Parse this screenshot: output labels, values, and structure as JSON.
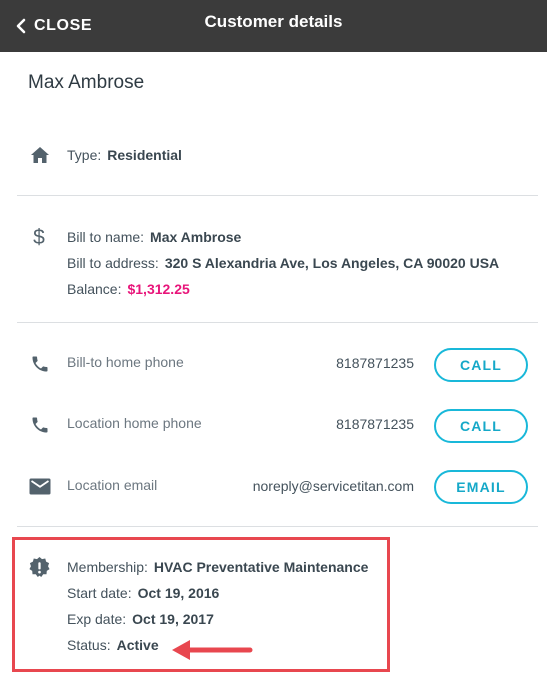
{
  "header": {
    "close_label": "CLOSE",
    "title": "Customer details",
    "close_icon": "chevron-left-icon"
  },
  "customer": {
    "name": "Max Ambrose"
  },
  "type_section": {
    "icon": "home-icon",
    "label": "Type:",
    "value": "Residential"
  },
  "billing": {
    "icon": "dollar-icon",
    "bill_to_name_label": "Bill to name:",
    "bill_to_name_value": "Max Ambrose",
    "bill_to_address_label": "Bill to address:",
    "bill_to_address_value": "320 S Alexandria Ave, Los Angeles, CA 90020 USA",
    "balance_label": "Balance:",
    "balance_value": "$1,312.25",
    "balance_color": "#e8157a"
  },
  "contacts": [
    {
      "icon": "phone-icon",
      "label": "Bill-to home phone",
      "value": "8187871235",
      "action": "CALL"
    },
    {
      "icon": "phone-icon",
      "label": "Location home phone",
      "value": "8187871235",
      "action": "CALL"
    },
    {
      "icon": "email-icon",
      "label": "Location email",
      "value": "noreply@servicetitan.com",
      "action": "EMAIL"
    }
  ],
  "membership": {
    "icon": "alert-badge-icon",
    "membership_label": "Membership:",
    "membership_value": "HVAC Preventative Maintenance",
    "start_label": "Start date:",
    "start_value": "Oct 19, 2016",
    "exp_label": "Exp date:",
    "exp_value": "Oct 19, 2017",
    "status_label": "Status:",
    "status_value": "Active"
  },
  "annotation": {
    "highlight_color": "#e8474f",
    "arrow_icon": "arrow-left-icon"
  },
  "colors": {
    "header_bg": "#3b3b3b",
    "accent": "#19b8d9",
    "text": "#3e4a52"
  }
}
